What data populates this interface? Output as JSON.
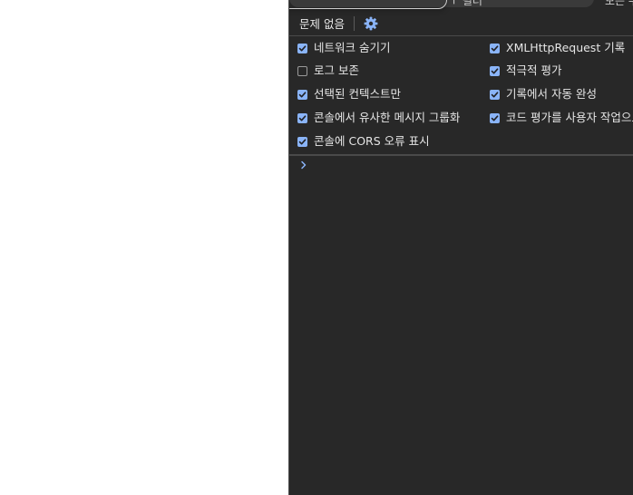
{
  "toolbar": {
    "partial_center_text": "ㅜ 필터",
    "partial_right_text": "모든 수"
  },
  "issues": {
    "label": "문제 없음"
  },
  "settings": {
    "left_options": [
      {
        "label": "네트워크 숨기기",
        "checked": true
      },
      {
        "label": "로그 보존",
        "checked": false
      },
      {
        "label": "선택된 컨텍스트만",
        "checked": true
      },
      {
        "label": "콘솔에서 유사한 메시지 그룹화",
        "checked": true
      },
      {
        "label": "콘솔에 CORS 오류 표시",
        "checked": true
      }
    ],
    "right_options": [
      {
        "label": "XMLHttpRequest 기록",
        "checked": true
      },
      {
        "label": "적극적 평가",
        "checked": true
      },
      {
        "label": "기록에서 자동 완성",
        "checked": true
      },
      {
        "label": "코드 평가를 사용자 작업으로 취급",
        "checked": true
      }
    ]
  },
  "icons": {
    "settings": "gear-icon",
    "prompt": "chevron-right-icon",
    "check": "checkmark-icon"
  },
  "colors": {
    "panel_bg": "#282828",
    "accent": "#8ab4f8",
    "text": "#e6e6e6"
  }
}
